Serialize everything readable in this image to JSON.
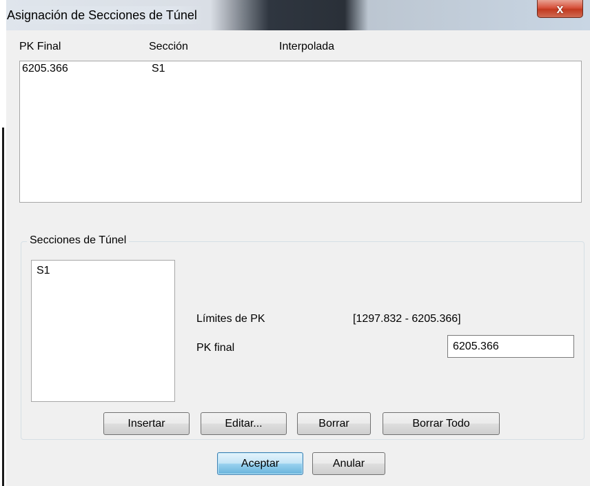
{
  "window": {
    "title": "Asignación de Secciones de Túnel",
    "close_glyph": "x"
  },
  "assignments": {
    "columns": [
      "PK Final",
      "Sección",
      "Interpolada"
    ],
    "rows": [
      {
        "pk_final": "6205.366",
        "seccion": "S1",
        "interpolada": ""
      }
    ]
  },
  "sections_group": {
    "title": "Secciones de Túnel",
    "items": [
      "S1"
    ],
    "limits_label": "Límites de PK",
    "limits_value": "[1297.832 - 6205.366]",
    "pk_final_label": "PK final",
    "pk_final_value": "6205.366",
    "buttons": {
      "insert": "Insertar",
      "edit": "Editar...",
      "delete": "Borrar",
      "delete_all": "Borrar Todo"
    }
  },
  "dialog_buttons": {
    "accept": "Aceptar",
    "cancel": "Anular"
  },
  "colors": {
    "dialog_bg": "#f0f0f0",
    "default_button": "#98d1ef",
    "close_button": "#c23a20"
  }
}
